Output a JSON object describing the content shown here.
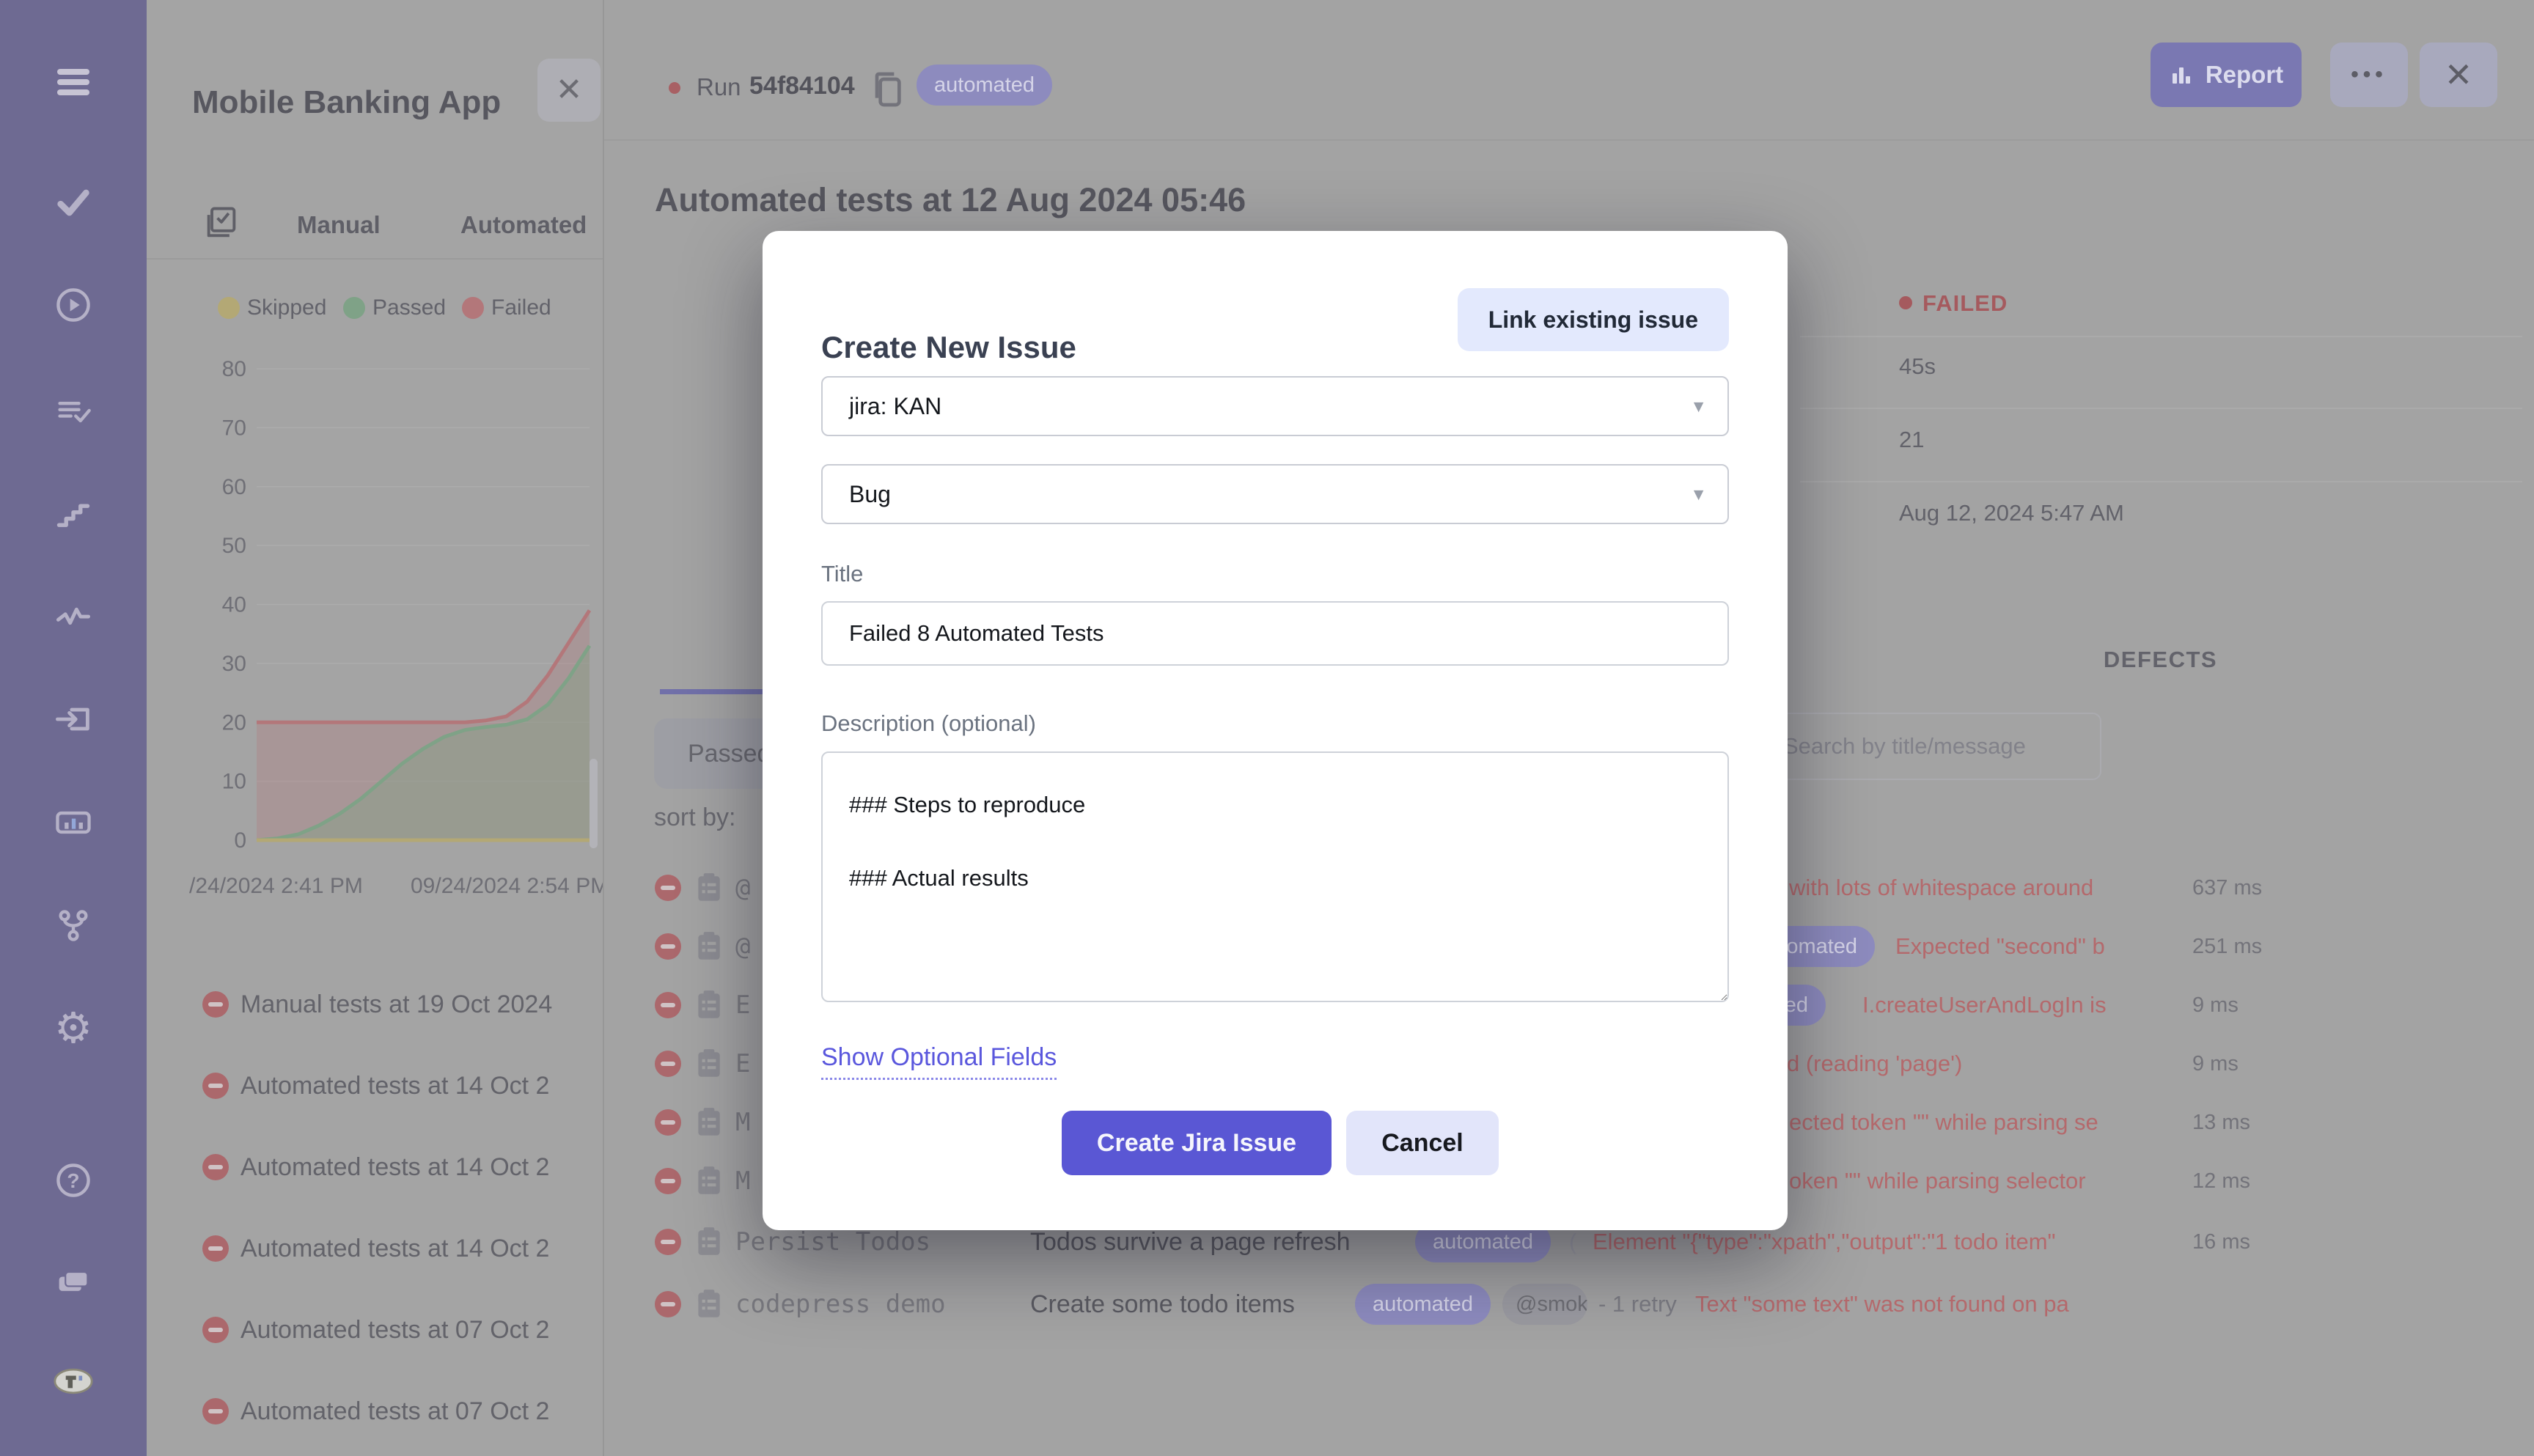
{
  "sidebar": {
    "icons": [
      "menu-icon",
      "check-icon",
      "play-circle-icon",
      "test-list-icon",
      "steps-icon",
      "pulse-icon",
      "import-icon",
      "report-chart-icon",
      "branch-icon",
      "gear-icon",
      "help-icon",
      "projects-icon",
      "app-logo"
    ]
  },
  "project_panel": {
    "title": "Mobile Banking App",
    "tabs": {
      "manual": "Manual",
      "automated": "Automated"
    },
    "legend": [
      {
        "label": "Skipped",
        "color": "#b3a875"
      },
      {
        "label": "Passed",
        "color": "#7fa287"
      },
      {
        "label": "Failed",
        "color": "#b3777a"
      }
    ],
    "runs": [
      {
        "label": "Manual tests at 19 Oct 2024"
      },
      {
        "label": "Automated tests at 14 Oct 2"
      },
      {
        "label": "Automated tests at 14 Oct 2"
      },
      {
        "label": "Automated tests at 14 Oct 2"
      },
      {
        "label": "Automated tests at 07 Oct 2"
      },
      {
        "label": "Automated tests at 07 Oct 2"
      }
    ]
  },
  "chart_data": {
    "type": "area",
    "title": "",
    "xlabel": "",
    "ylabel": "",
    "ylim": [
      0,
      80
    ],
    "y_ticks": [
      0,
      10,
      20,
      30,
      40,
      50,
      60,
      70,
      80
    ],
    "x_labels": [
      "/24/2024 2:41 PM",
      "09/24/2024 2:54 PM"
    ],
    "grid": true,
    "legend_position": "top",
    "series": [
      {
        "name": "Failed",
        "color": "#b3777a",
        "fill": "rgba(179,119,122,0.30)",
        "values": [
          20,
          20,
          20,
          20,
          20,
          20,
          20,
          20,
          20,
          20,
          20,
          20.3,
          21,
          23.5,
          28,
          33.5,
          39
        ]
      },
      {
        "name": "Passed",
        "color": "#7fa287",
        "fill": "rgba(127,162,135,0.40)",
        "values": [
          0,
          0.3,
          1,
          2.5,
          4.5,
          7,
          10,
          13,
          15.5,
          17.5,
          18.7,
          19.2,
          19.6,
          20.5,
          23,
          27.5,
          33
        ]
      },
      {
        "name": "Skipped",
        "color": "#b3a875",
        "fill": "none",
        "values": [
          0,
          0,
          0,
          0,
          0,
          0,
          0,
          0,
          0,
          0,
          0,
          0,
          0,
          0,
          0,
          0,
          0
        ]
      }
    ]
  },
  "run_header": {
    "run_label": "Run",
    "run_id": "54f84104",
    "badge": "automated",
    "report_label": "Report",
    "heading": "Automated tests at 12 Aug 2024 05:46"
  },
  "run_page": {
    "passed_tab": "Passed",
    "sort_by_label": "sort by:",
    "defects_title": "DEFECTS",
    "search_placeholder": "Search by title/message",
    "details": {
      "status": "FAILED",
      "duration": "45s",
      "tests_count": "21",
      "finished_at": "Aug 12, 2024 5:47 AM"
    },
    "rows": [
      {
        "suite": "@",
        "error": "with lots of whitespace around",
        "duration": "637 ms"
      },
      {
        "suite": "@",
        "badge": "automated",
        "error": "Expected \"second\" b",
        "duration": "251 ms"
      },
      {
        "suite": "E",
        "badge": "automated",
        "error": "I.createUserAndLogIn is",
        "duration": "9 ms"
      },
      {
        "suite": "E",
        "error": "d (reading 'page')",
        "duration": "9 ms"
      },
      {
        "suite": "M",
        "error": "ected token \"\" while parsing se",
        "duration": "13 ms"
      },
      {
        "suite": "M",
        "error": "oken \"\" while parsing selector",
        "duration": "12 ms"
      },
      {
        "suite": "Persist Todos",
        "title": "Todos survive a page refresh",
        "badge": "automated",
        "prefix": "(",
        "error": "Element \"{\"type\":\"xpath\",\"output\":\"1 todo item\"",
        "duration": "16 ms"
      },
      {
        "suite": "codepress demo",
        "title": "Create some todo items",
        "badge": "automated",
        "tag": "@smok",
        "retry": "- 1 retry",
        "error": "Text \"some text\" was not found on pa",
        "duration": ""
      }
    ]
  },
  "modal": {
    "title": "Create New Issue",
    "link_existing": "Link existing issue",
    "project_select": "jira: KAN",
    "type_select": "Bug",
    "title_label": "Title",
    "title_value": "Failed 8 Automated Tests",
    "description_label": "Description (optional)",
    "description_value": "### Steps to reproduce\n\n### Actual results",
    "show_optional": "Show Optional Fields",
    "submit_label": "Create Jira Issue",
    "cancel_label": "Cancel"
  }
}
